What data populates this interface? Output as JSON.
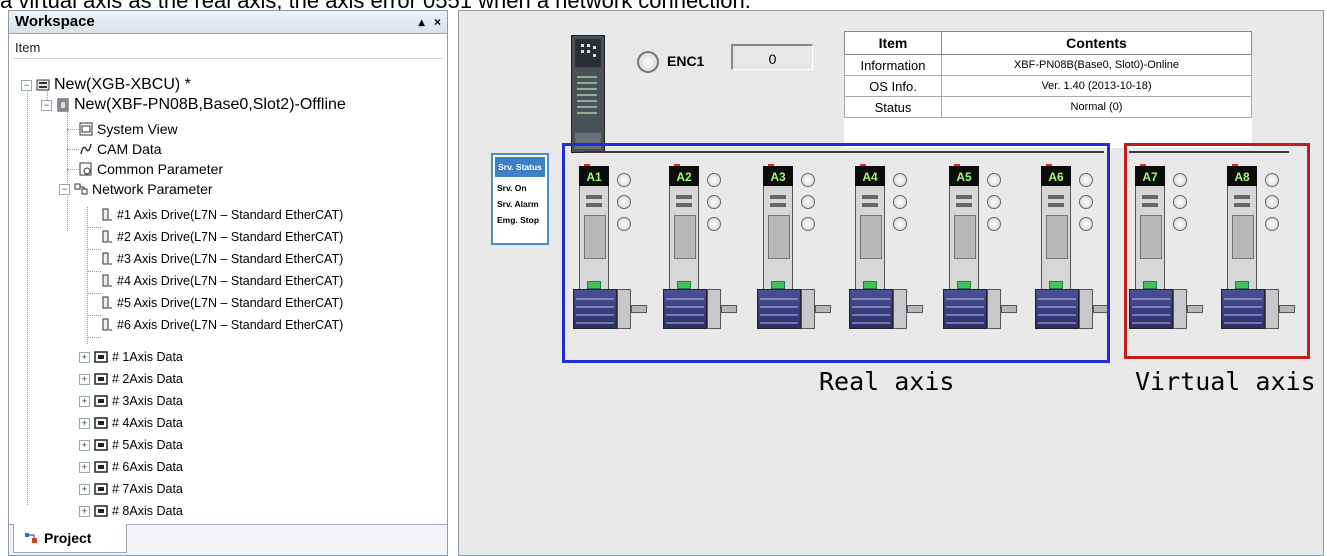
{
  "caption": "a virtual axis as the real axis, the axis error 0551 when a network connection.",
  "workspace": {
    "title": "Workspace",
    "controls": [
      "▴",
      "×"
    ],
    "column_header": "Item",
    "tree": {
      "root": "New(XGB-XBCU) *",
      "module": "New(XBF-PN08B,Base0,Slot2)-Offline",
      "system_view": "System View",
      "cam_data": "CAM Data",
      "common_parameter": "Common Parameter",
      "network_parameter": "Network Parameter",
      "drives": [
        "#1 Axis Drive(L7N – Standard EtherCAT)",
        "#2 Axis Drive(L7N – Standard EtherCAT)",
        "#3 Axis Drive(L7N – Standard EtherCAT)",
        "#4 Axis Drive(L7N – Standard EtherCAT)",
        "#5 Axis Drive(L7N – Standard EtherCAT)",
        "#6 Axis Drive(L7N – Standard EtherCAT)"
      ],
      "axis_data": [
        "# 1Axis Data",
        "# 2Axis Data",
        "# 3Axis Data",
        "# 4Axis Data",
        "# 5Axis Data",
        "# 6Axis Data",
        "# 7Axis Data",
        "# 8Axis Data"
      ]
    },
    "tab": "Project"
  },
  "monitor": {
    "encoder": {
      "label": "ENC1",
      "value": "0"
    },
    "table": {
      "headers": [
        "Item",
        "Contents"
      ],
      "rows": [
        [
          "Information",
          "XBF-PN08B(Base0,  Slot0)-Online"
        ],
        [
          "OS Info.",
          "Ver. 1.40 (2013-10-18)"
        ],
        [
          "Status",
          "Normal (0)"
        ]
      ]
    },
    "servo_status": {
      "title": "Srv. Status",
      "items": [
        "Srv. On",
        "Srv. Alarm",
        "Emg. Stop"
      ]
    },
    "axes": [
      "A1",
      "A2",
      "A3",
      "A4",
      "A5",
      "A6",
      "A7",
      "A8"
    ],
    "labels": {
      "real": "Real axis",
      "virtual": "Virtual axis"
    },
    "colors": {
      "real_box": "#1f2ed8",
      "virtual_box": "#c21e1e",
      "axis_label": "#9eff6a"
    }
  }
}
